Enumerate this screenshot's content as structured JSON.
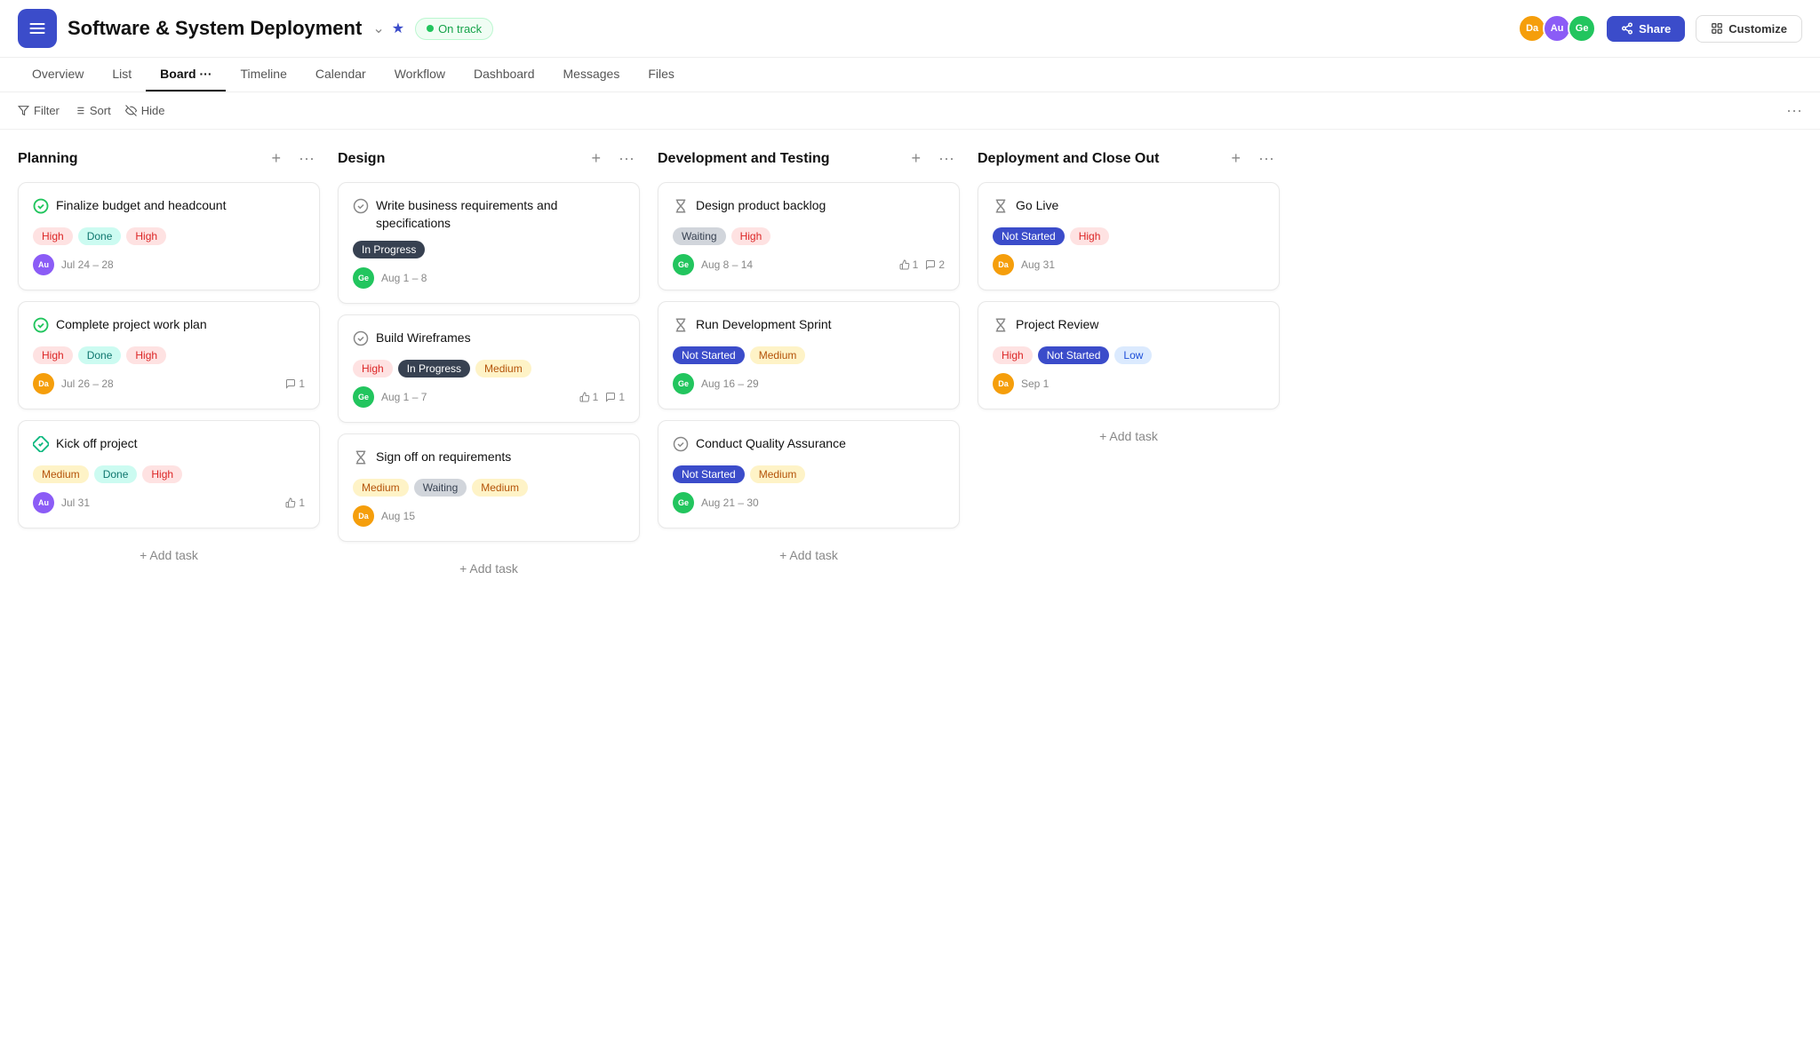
{
  "app": {
    "menu_icon": "☰",
    "title": "Software & System Deployment",
    "status": "On track",
    "share_label": "Share",
    "customize_label": "Customize",
    "avatars": [
      {
        "initials": "Da",
        "color": "#f59e0b"
      },
      {
        "initials": "Au",
        "color": "#8b5cf6"
      },
      {
        "initials": "Ge",
        "color": "#22c55e"
      }
    ]
  },
  "nav": {
    "tabs": [
      "Overview",
      "List",
      "Board",
      "Timeline",
      "Calendar",
      "Workflow",
      "Dashboard",
      "Messages",
      "Files"
    ],
    "active": "Board"
  },
  "toolbar": {
    "filter": "Filter",
    "sort": "Sort",
    "hide": "Hide"
  },
  "board": {
    "columns": [
      {
        "id": "planning",
        "title": "Planning",
        "cards": [
          {
            "id": "c1",
            "icon": "check-circle",
            "icon_symbol": "✅",
            "title": "Finalize budget and headcount",
            "tags": [
              {
                "label": "High",
                "type": "high"
              },
              {
                "label": "Done",
                "type": "done"
              },
              {
                "label": "High",
                "type": "high"
              }
            ],
            "avatar": {
              "initials": "Au",
              "color": "#8b5cf6"
            },
            "date": "Jul 24 – 28",
            "likes": null,
            "comments": null
          },
          {
            "id": "c2",
            "icon": "check-circle",
            "icon_symbol": "✅",
            "title": "Complete project work plan",
            "tags": [
              {
                "label": "High",
                "type": "high"
              },
              {
                "label": "Done",
                "type": "done"
              },
              {
                "label": "High",
                "type": "high"
              }
            ],
            "avatar": {
              "initials": "Da",
              "color": "#f59e0b"
            },
            "date": "Jul 26 – 28",
            "likes": null,
            "comments": "1"
          },
          {
            "id": "c3",
            "icon": "check-diamond",
            "icon_symbol": "✳️",
            "title": "Kick off project",
            "tags": [
              {
                "label": "Medium",
                "type": "medium"
              },
              {
                "label": "Done",
                "type": "done"
              },
              {
                "label": "High",
                "type": "high"
              }
            ],
            "avatar": {
              "initials": "Au",
              "color": "#8b5cf6"
            },
            "date": "Jul 31",
            "likes": "1",
            "comments": null
          }
        ],
        "add_task": "+ Add task"
      },
      {
        "id": "design",
        "title": "Design",
        "cards": [
          {
            "id": "c4",
            "icon": "circle-check",
            "icon_symbol": "◎",
            "title": "Write business requirements and specifications",
            "tags": [
              {
                "label": "In Progress",
                "type": "in-progress"
              }
            ],
            "avatar": {
              "initials": "Ge",
              "color": "#22c55e"
            },
            "date": "Aug 1 – 8",
            "likes": null,
            "comments": null
          },
          {
            "id": "c5",
            "icon": "circle-check",
            "icon_symbol": "◎",
            "title": "Build Wireframes",
            "tags": [
              {
                "label": "High",
                "type": "high"
              },
              {
                "label": "In Progress",
                "type": "in-progress"
              },
              {
                "label": "Medium",
                "type": "medium"
              }
            ],
            "avatar": {
              "initials": "Ge",
              "color": "#22c55e"
            },
            "date": "Aug 1 – 7",
            "likes": "1",
            "comments": "1"
          },
          {
            "id": "c6",
            "icon": "hourglass",
            "icon_symbol": "⌛",
            "title": "Sign off on requirements",
            "tags": [
              {
                "label": "Medium",
                "type": "medium"
              },
              {
                "label": "Waiting",
                "type": "waiting"
              },
              {
                "label": "Medium",
                "type": "medium"
              }
            ],
            "avatar": {
              "initials": "Da",
              "color": "#f59e0b"
            },
            "date": "Aug 15",
            "likes": null,
            "comments": null
          }
        ],
        "add_task": "+ Add task"
      },
      {
        "id": "dev-testing",
        "title": "Development and Testing",
        "cards": [
          {
            "id": "c7",
            "icon": "hourglass",
            "icon_symbol": "⌛",
            "title": "Design product backlog",
            "tags": [
              {
                "label": "Waiting",
                "type": "waiting"
              },
              {
                "label": "High",
                "type": "high"
              }
            ],
            "avatar": {
              "initials": "Ge",
              "color": "#22c55e"
            },
            "date": "Aug 8 – 14",
            "likes": "1",
            "comments": "2"
          },
          {
            "id": "c8",
            "icon": "hourglass",
            "icon_symbol": "⌛",
            "title": "Run Development Sprint",
            "tags": [
              {
                "label": "Not Started",
                "type": "not-started"
              },
              {
                "label": "Medium",
                "type": "medium"
              }
            ],
            "avatar": {
              "initials": "Ge",
              "color": "#22c55e"
            },
            "date": "Aug 16 – 29",
            "likes": null,
            "comments": null
          },
          {
            "id": "c9",
            "icon": "circle-check",
            "icon_symbol": "◎",
            "title": "Conduct Quality Assurance",
            "tags": [
              {
                "label": "Not Started",
                "type": "not-started"
              },
              {
                "label": "Medium",
                "type": "medium"
              }
            ],
            "avatar": {
              "initials": "Ge",
              "color": "#22c55e"
            },
            "date": "Aug 21 – 30",
            "likes": null,
            "comments": null
          }
        ],
        "add_task": "+ Add task"
      },
      {
        "id": "deployment",
        "title": "Deployment and Close Out",
        "cards": [
          {
            "id": "c10",
            "icon": "hourglass",
            "icon_symbol": "⌛",
            "title": "Go Live",
            "tags": [
              {
                "label": "Not Started",
                "type": "not-started"
              },
              {
                "label": "High",
                "type": "high"
              }
            ],
            "avatar": {
              "initials": "Da",
              "color": "#f59e0b"
            },
            "date": "Aug 31",
            "likes": null,
            "comments": null
          },
          {
            "id": "c11",
            "icon": "hourglass",
            "icon_symbol": "⌛",
            "title": "Project Review",
            "tags": [
              {
                "label": "High",
                "type": "high"
              },
              {
                "label": "Not Started",
                "type": "not-started"
              },
              {
                "label": "Low",
                "type": "low"
              }
            ],
            "avatar": {
              "initials": "Da",
              "color": "#f59e0b"
            },
            "date": "Sep 1",
            "likes": null,
            "comments": null
          }
        ],
        "add_task": "+ Add task"
      }
    ]
  }
}
